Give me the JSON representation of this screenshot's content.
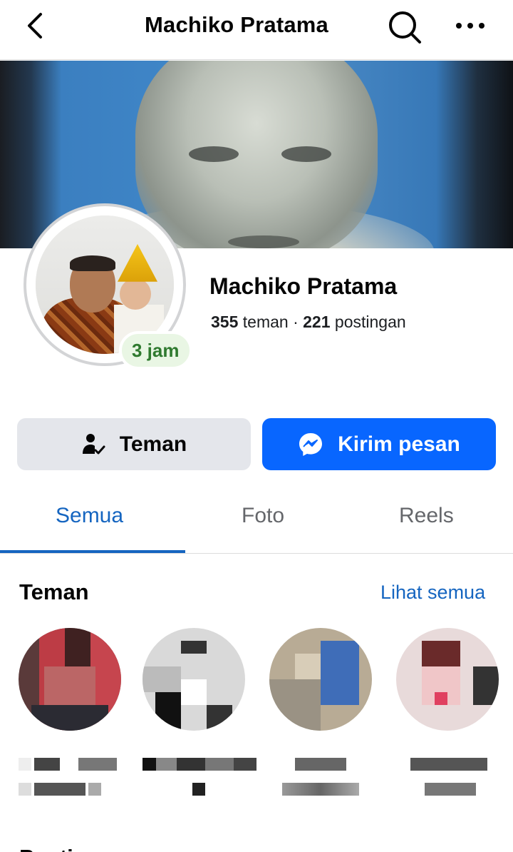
{
  "header": {
    "title": "Machiko Pratama"
  },
  "profile": {
    "name": "Machiko Pratama",
    "friends_count": "355",
    "friends_label": " teman · ",
    "posts_count": "221",
    "posts_label": " postingan",
    "story_badge": "3 jam"
  },
  "actions": {
    "friend_label": "Teman",
    "message_label": "Kirim pesan"
  },
  "tabs": [
    {
      "label": "Semua",
      "active": true
    },
    {
      "label": "Foto",
      "active": false
    },
    {
      "label": "Reels",
      "active": false
    }
  ],
  "friends_section": {
    "title": "Teman",
    "see_all": "Lihat semua"
  },
  "posts_section": {
    "title": "Postingan"
  },
  "colors": {
    "accent": "#0866ff",
    "tab_active": "#1565c0",
    "badge_text": "#2f7a2f"
  }
}
